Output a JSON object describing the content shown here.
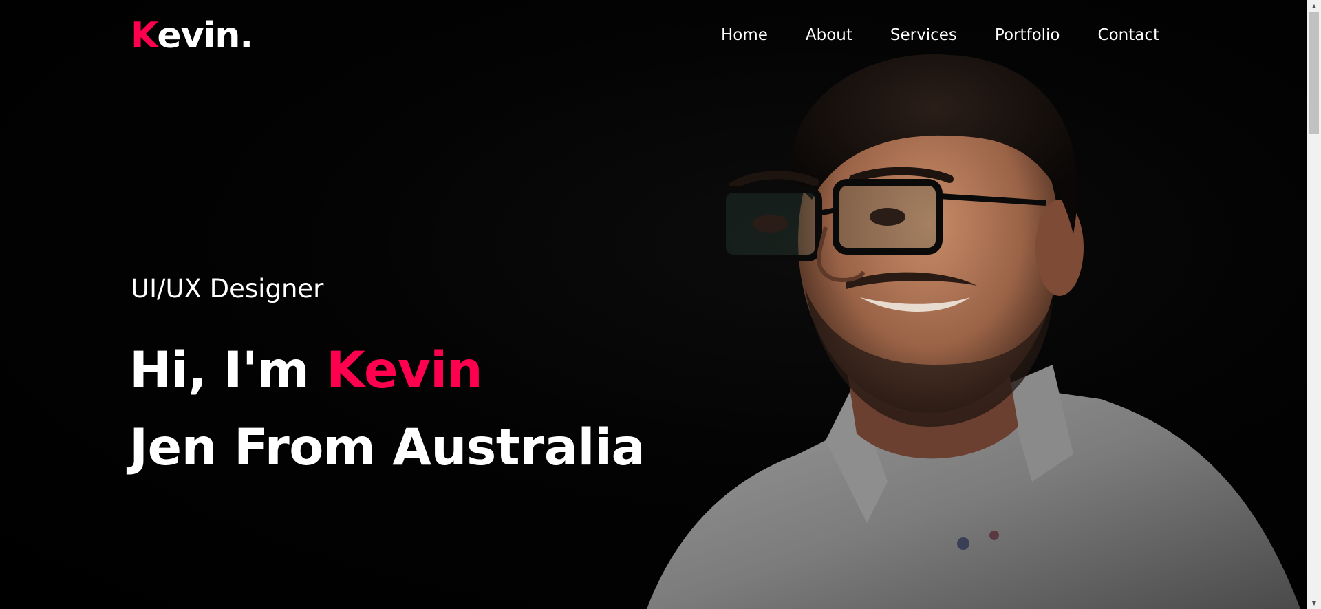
{
  "header": {
    "logo_initial": "K",
    "logo_rest": "evin.",
    "nav": [
      {
        "label": "Home"
      },
      {
        "label": "About"
      },
      {
        "label": "Services"
      },
      {
        "label": "Portfolio"
      },
      {
        "label": "Contact"
      }
    ]
  },
  "hero": {
    "role": "UI/UX Designer",
    "greeting_prefix": "Hi, I'm ",
    "greeting_name": "Kevin",
    "line_two": "Jen From Australia"
  },
  "colors": {
    "accent": "#ff004f",
    "background": "#000000",
    "text": "#ffffff"
  },
  "icons": {
    "scroll_up": "up-arrow-icon",
    "scroll_down": "down-arrow-icon"
  }
}
